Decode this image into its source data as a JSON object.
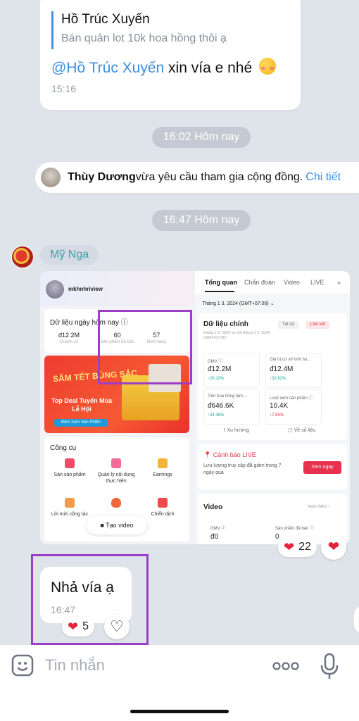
{
  "quoted_message": {
    "quote_author": "Hồ Trúc Xuyến",
    "quote_text": "Bán quân lot 10k hoa hồng thôi ạ",
    "mention": "@Hồ Trúc Xuyến",
    "text": " xin vía e nhé ",
    "time": "15:16"
  },
  "time_pill_1": "16:02 Hôm nay",
  "notice": {
    "user": "Thùy Dương",
    "text": " vừa yêu cầu tham gia cộng đồng.",
    "link": "Chi tiết"
  },
  "time_pill_2": "16:47 Hôm nay",
  "sender_name": "Mỹ Nga",
  "screenshot": {
    "left": {
      "username": "mkhnhriview",
      "data_title": "Dữ liệu ngày hôm nay ⓘ",
      "stats": [
        {
          "value": "đ12.2M",
          "label": "Doanh số"
        },
        {
          "value": "60",
          "label": "Sản phẩm đã bán"
        },
        {
          "value": "57",
          "label": "Đơn hàng"
        }
      ],
      "banner_title": "SĂM TẾT BÙNG SẮC",
      "banner_sub": "Top Deal Tuyển Mùa Lễ Hội",
      "banner_btn": "Bấm Xem Sản Phẩm",
      "tools_title": "Công cụ",
      "tools": [
        "Sàn sản phẩm",
        "Quản lý nội dung thực hiện",
        "Earnings",
        "Lời mời cộng tác",
        "",
        "Chiến dịch"
      ],
      "video_chip": "Tạo video"
    },
    "right": {
      "tabs": [
        "Tổng quan",
        "Chẩn đoán",
        "Video",
        "LIVE"
      ],
      "date": "Tháng 1 3, 2024 (GMT+07:00) ⌄",
      "main_title": "Dữ liệu chính",
      "main_sub": "tháng 1 3, 2024 so với tháng 1 2, 2024 (GMT+07:00)",
      "tag_all": "Tất cả",
      "tag_link": "Liên kết",
      "metrics": [
        {
          "label": "GMV ⓘ",
          "value": "đ12.2M",
          "pct": "↑28.10%",
          "dir": "up"
        },
        {
          "label": "Giá trị cơ sở tính ho...",
          "value": "đ12.4M",
          "pct": "↑32.62%",
          "dir": "up"
        },
        {
          "label": "Tiền hoa hồng tạm ...",
          "value": "đ646.6K",
          "pct": "↑34.36%",
          "dir": "up"
        },
        {
          "label": "Lượt xem sản phẩm ⓘ",
          "value": "10.4K",
          "pct": "↓7.85%",
          "dir": "down"
        }
      ],
      "link_trend": "Xu hướng",
      "link_detail": "Về số liệu",
      "warn_title": "Cảnh báo LIVE",
      "warn_text": "Lưu lượng truy cập đã giảm trong 7 ngày qua",
      "warn_btn": "Xem ngay",
      "video_title": "Video",
      "video_more": "Xem thêm ›",
      "video_gmv_label": "GMV ⓘ",
      "video_gmv": "đ0",
      "video_sold_label": "Sản phẩm đã bán ⓘ",
      "video_sold": "0"
    }
  },
  "image_reaction_count": "22",
  "bottom_message": {
    "text": "Nhả vía ạ",
    "time": "16:47",
    "reaction_count": "5"
  },
  "input": {
    "placeholder": "Tin nhắn"
  },
  "colors": {
    "background": "#dfe3ea",
    "accent_blue": "#3b8ee0",
    "highlight_purple": "#9b3fc7",
    "heart_red": "#e5243b"
  }
}
